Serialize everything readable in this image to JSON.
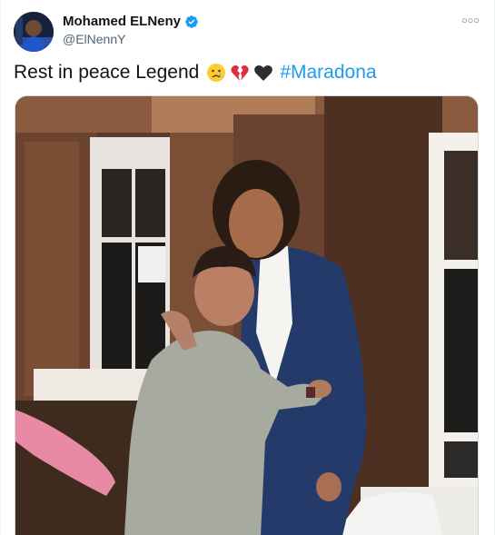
{
  "tweet": {
    "display_name": "Mohamed ELNeny",
    "handle": "@ElNennY",
    "text": "Rest in peace Legend",
    "emojis": [
      "crying-face-emoji",
      "broken-heart-emoji",
      "black-heart-emoji"
    ],
    "hashtag": "#Maradona",
    "verified": true,
    "more_icon": "more-horizontal-icon"
  },
  "colors": {
    "text": "#0f1419",
    "secondary": "#536471",
    "link": "#1d9bf0",
    "verified": "#1d9bf0",
    "border": "#cfd9de"
  }
}
